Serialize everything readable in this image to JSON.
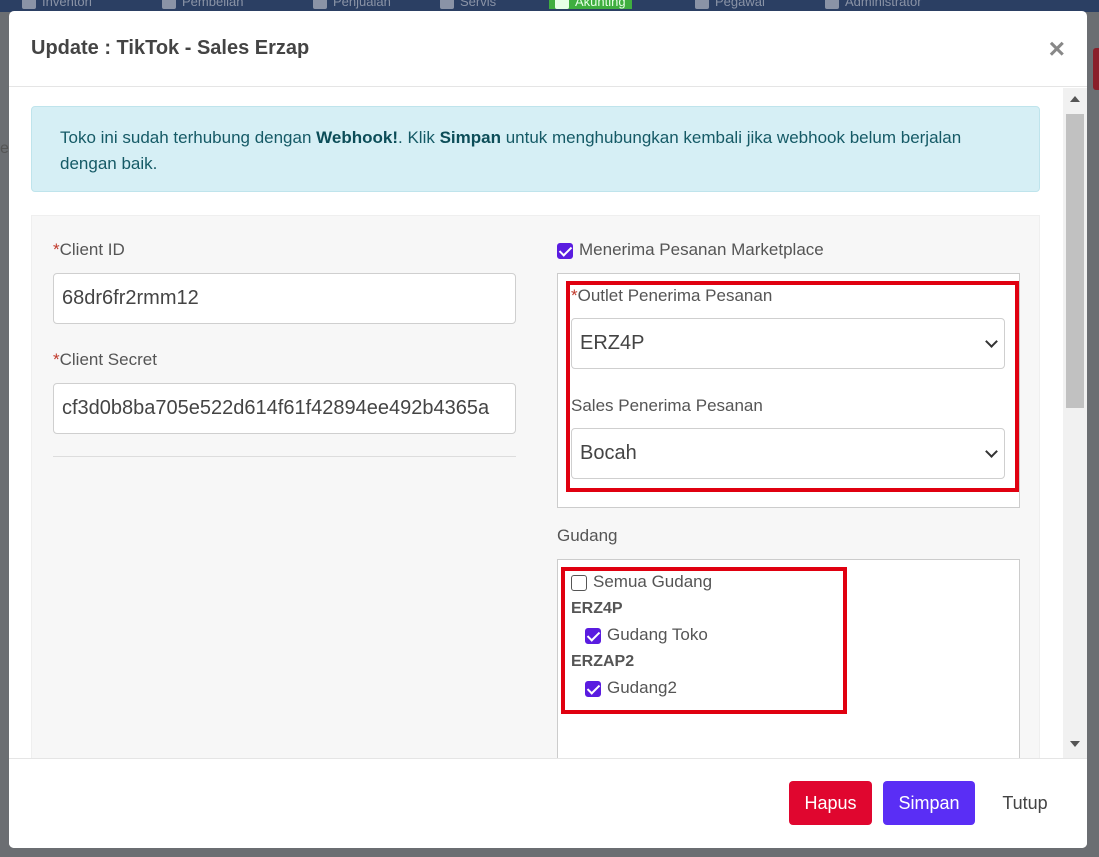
{
  "background": {
    "nav_items": [
      "Inventori",
      "Pembelian",
      "Penjualan",
      "Servis",
      "Akunting",
      "Pegawai",
      "Administrator"
    ],
    "left_text": "e"
  },
  "modal": {
    "title": "Update : TikTok - Sales Erzap",
    "close_label": "×"
  },
  "alert": {
    "text_1": "Toko ini sudah terhubung dengan ",
    "bold_1": "Webhook!",
    "text_2": ". Klik ",
    "bold_2": "Simpan",
    "text_3": " untuk menghubungkan kembali jika webhook belum berjalan dengan baik."
  },
  "form": {
    "required_mark": "*",
    "client_id_label": "Client ID",
    "client_id_value": "68dr6fr2rmm12",
    "client_secret_label": "Client Secret",
    "client_secret_value": "cf3d0b8ba705e522d614f61f42894ee492b4365a",
    "marketplace_checkbox_label": "Menerima Pesanan Marketplace",
    "marketplace_checked": true,
    "outlet_label": "Outlet Penerima Pesanan",
    "outlet_value": "ERZ4P",
    "sales_label": "Sales Penerima Pesanan",
    "sales_value": "Bocah",
    "gudang_label": "Gudang",
    "all_gudang_label": "Semua Gudang",
    "all_gudang_checked": false,
    "groups": [
      {
        "name": "ERZ4P",
        "items": [
          {
            "label": "Gudang Toko",
            "checked": true
          }
        ]
      },
      {
        "name": "ERZAP2",
        "items": [
          {
            "label": "Gudang2",
            "checked": true
          }
        ]
      }
    ]
  },
  "footer": {
    "delete_label": "Hapus",
    "save_label": "Simpan",
    "close_label": "Tutup"
  },
  "colors": {
    "primary": "#5a2ef5",
    "danger": "#e0062f",
    "highlight": "#e00010",
    "alert_bg": "#d6eff5"
  }
}
